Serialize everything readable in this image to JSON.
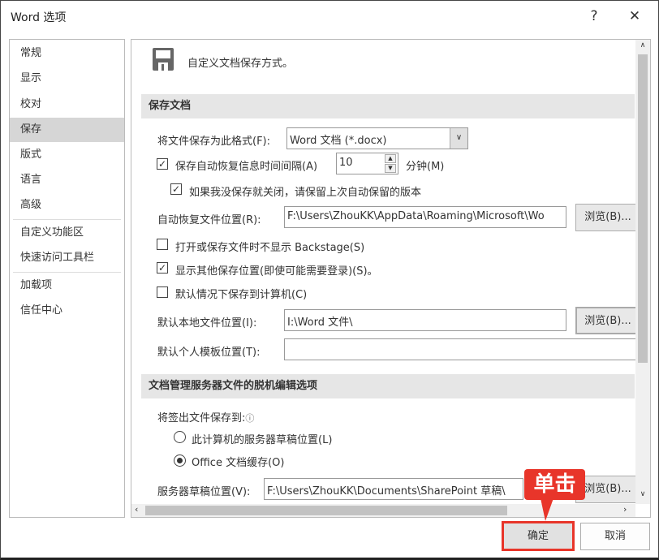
{
  "window": {
    "title": "Word 选项",
    "help": "?",
    "close": "✕"
  },
  "sidebar": {
    "items": [
      {
        "label": "常规"
      },
      {
        "label": "显示"
      },
      {
        "label": "校对"
      },
      {
        "label": "保存"
      },
      {
        "label": "版式"
      },
      {
        "label": "语言"
      },
      {
        "label": "高级"
      },
      {
        "label": "自定义功能区"
      },
      {
        "label": "快速访问工具栏"
      },
      {
        "label": "加载项"
      },
      {
        "label": "信任中心"
      }
    ],
    "selected": "保存"
  },
  "header": {
    "text": "自定义文档保存方式。"
  },
  "save_section": {
    "title": "保存文档",
    "format_label": "将文件保存为此格式(F):",
    "format_value": "Word 文档 (*.docx)",
    "autorecover_label": "保存自动恢复信息时间间隔(A)",
    "autorecover_checked": true,
    "interval": "10",
    "minutes_label": "分钟(M)",
    "keep_last_label": "如果我没保存就关闭，请保留上次自动保留的版本",
    "keep_last_checked": true,
    "autorecover_loc_label": "自动恢复文件位置(R):",
    "autorecover_loc_value": "F:\\Users\\ZhouKK\\AppData\\Roaming\\Microsoft\\Wo",
    "browse": "浏览(B)...",
    "no_backstage_label": "打开或保存文件时不显示 Backstage(S)",
    "no_backstage_checked": false,
    "show_other_label": "显示其他保存位置(即使可能需要登录)(S)。",
    "show_other_checked": true,
    "save_to_computer_label": "默认情况下保存到计算机(C)",
    "save_to_computer_checked": false,
    "local_loc_label": "默认本地文件位置(I):",
    "local_loc_value": "I:\\Word 文件\\",
    "template_loc_label": "默认个人模板位置(T):",
    "template_loc_value": ""
  },
  "offline_section": {
    "title": "文档管理服务器文件的脱机编辑选项",
    "checkout_label": "将签出文件保存到:",
    "info_icon": "ⓘ",
    "option_server": "此计算机的服务器草稿位置(L)",
    "option_cache": "Office 文档缓存(O)",
    "selected": "Office 文档缓存(O)",
    "server_loc_label": "服务器草稿位置(V):",
    "server_loc_value": "F:\\Users\\ZhouKK\\Documents\\SharePoint 草稿\\"
  },
  "footer": {
    "ok": "确定",
    "cancel": "取消"
  },
  "annotation": {
    "text": "单击",
    "color": "#e8352a"
  }
}
